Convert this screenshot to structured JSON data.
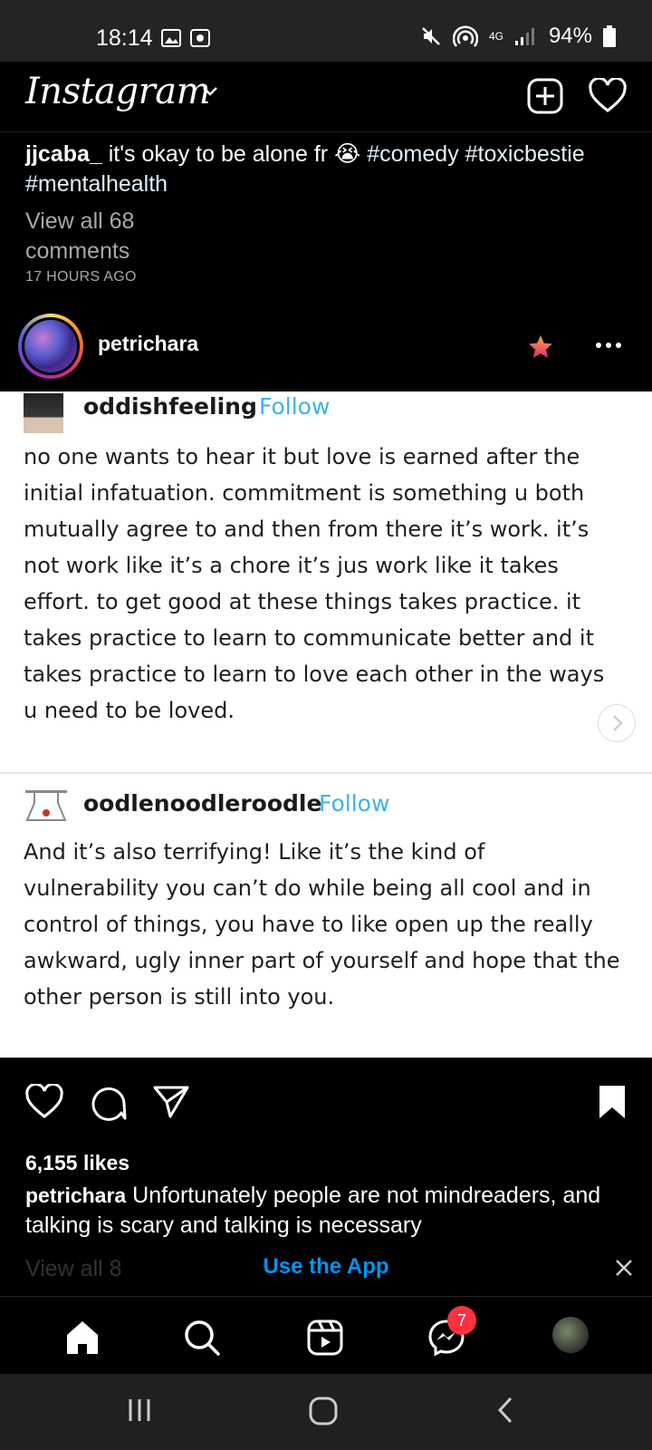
{
  "status_bar": {
    "time": "18:14",
    "battery": "94%",
    "network": "4G"
  },
  "app": {
    "logo": "Instagram"
  },
  "prev_post": {
    "user": "jjcaba_",
    "caption": " it's okay to be alone fr 😭 ",
    "hashtags": "#comedy #toxicbestie #mentalhealth",
    "view_comments": "View all 68 comments",
    "time_ago": "17 HOURS AGO"
  },
  "post": {
    "user": "petrichara",
    "image": {
      "block1": {
        "user": "oddishfeeling",
        "follow": "Follow",
        "text": "no one wants to hear it but love is earned after the initial infatuation. commitment is something u both mutually agree to and then from there it’s work. it’s not work like it’s a chore it’s jus work like it takes effort. to get good at these things takes practice. it takes practice to learn to communicate better and it takes practice to learn to love each other in the ways u need to be loved."
      },
      "block2": {
        "user": "oodlenoodleroodle",
        "follow": "Follow",
        "text": "And it’s also terrifying! Like it’s the kind of vulnerability you can’t do while being all cool and in control of things, you have to like open up the really awkward, ugly inner part of yourself and hope that the other person is still into you."
      }
    },
    "likes": "6,155 likes",
    "caption_user": "petrichara",
    "caption": " Unfortunately people are not mindreaders, and talking is scary and talking is necessary",
    "view_comments": "View all 8"
  },
  "use_app_banner": {
    "label": "Use the App"
  },
  "bottom_nav": {
    "messages_badge": "7"
  },
  "colors": {
    "accent": "#0095f6",
    "follow": "#3eb3e8",
    "badge": "#ff3040"
  }
}
